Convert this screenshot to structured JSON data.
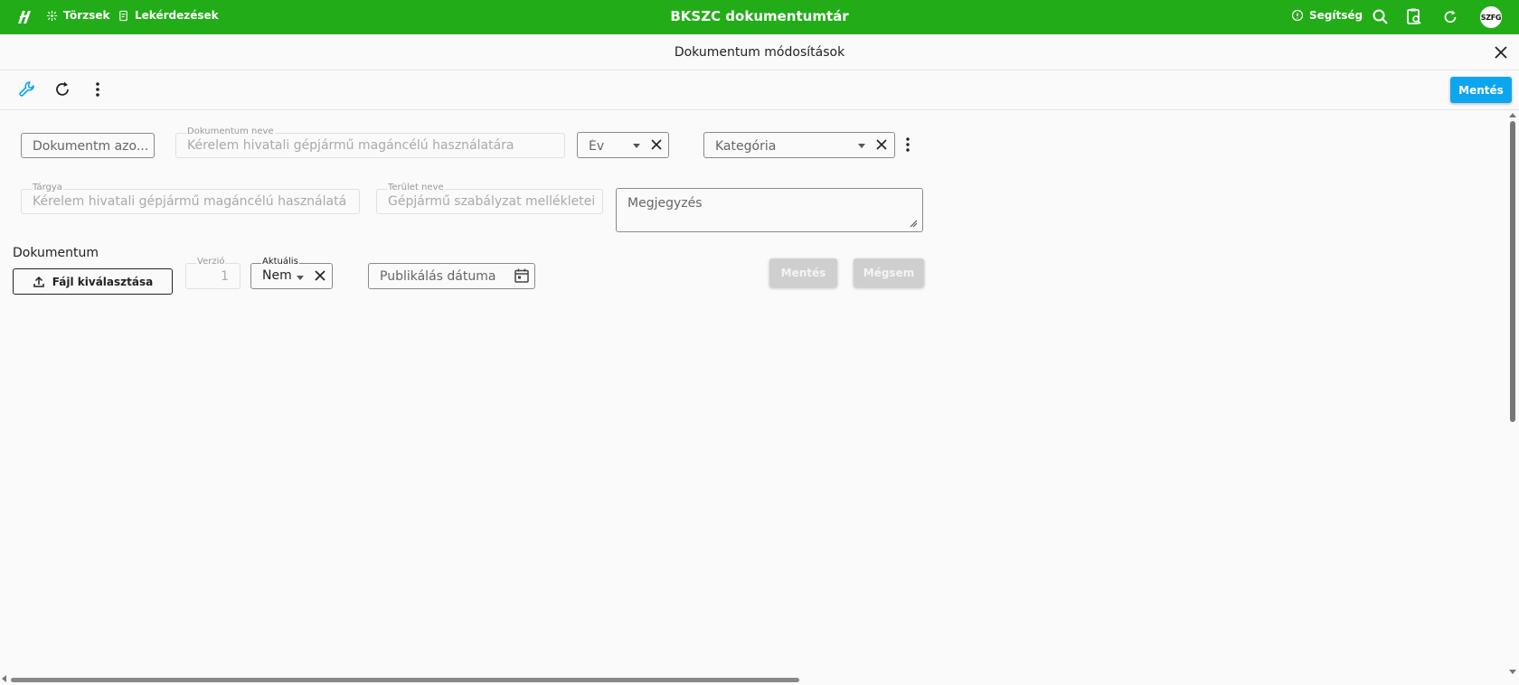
{
  "topbar": {
    "nav_torzsek": "Törzsek",
    "nav_lekerdezesek": "Lekérdezések",
    "app_title": "BKSZC dokumentumtár",
    "help": "Segítség",
    "avatar": "SZFG"
  },
  "titlebar": {
    "title": "Dokumentum módosítások"
  },
  "toolbar": {
    "save_label": "Mentés"
  },
  "form": {
    "doc_id": {
      "placeholder": "Dokumentm azo..."
    },
    "doc_name": {
      "label": "Dokumentum neve",
      "value": "Kérelem hivatali gépjármű magáncélú használatára"
    },
    "year": {
      "placeholder": "Év"
    },
    "category": {
      "placeholder": "Kategória"
    },
    "subject": {
      "label": "Tárgya",
      "value": "Kérelem hivatali gépjármű magáncélú használatá"
    },
    "area": {
      "label": "Terület neve",
      "value": "Gépjármű szabályzat mellékletei"
    },
    "note": {
      "placeholder": "Megjegyzés"
    }
  },
  "document": {
    "section_label": "Dokumentum",
    "file_button": "Fájl kiválasztása",
    "version": {
      "label": "Verzió",
      "value": "1"
    },
    "current": {
      "label": "Aktuális",
      "value": "Nem"
    },
    "publish_date": {
      "placeholder": "Publikálás dátuma"
    },
    "save_button": "Mentés",
    "cancel_button": "Mégsem"
  },
  "colors": {
    "topbar": "#22ad18",
    "primary": "#0ea5ef",
    "disabled_button": "#cfcfcf"
  }
}
